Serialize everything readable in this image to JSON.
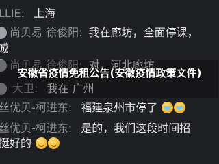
{
  "messages": [
    {
      "sender": "LLIE:",
      "text": "上海"
    },
    {
      "sender": "尚贝易 徐俊阳:",
      "text": "我在廊坊，全面停课，"
    },
    {
      "sender": "",
      "text": "诚"
    },
    {
      "sender": "尚贝易 徐俊阳:",
      "text": "对，河北廊坊"
    },
    {
      "sender": "大卫:",
      "text": "我在 广州"
    },
    {
      "sender": "丝优贝-柯进东:",
      "text": "福建泉州市停了"
    },
    {
      "sender": "丝优贝-柯进东:",
      "text": "是的，我们这段时间招"
    },
    {
      "sender": "",
      "text": "挺好的"
    }
  ],
  "headline": "安徽省疫情免租公告(安徽疫情政策文件)",
  "emojis": [
    "crying-face",
    "crying-face",
    "grinning-face",
    "grinning-face"
  ]
}
